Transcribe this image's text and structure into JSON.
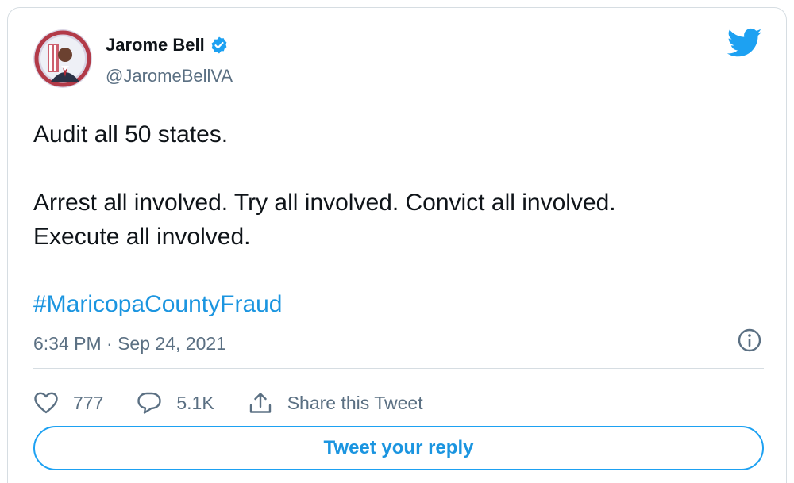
{
  "author": {
    "name": "Jarome Bell",
    "handle": "@JaromeBellVA",
    "verified": true
  },
  "tweet": {
    "line1": "Audit all 50 states.",
    "line2": "Arrest all involved. Try all involved. Convict all involved.",
    "line3": "Execute all involved.",
    "hashtag": "#MaricopaCountyFraud",
    "timestamp": "6:34 PM · Sep 24, 2021"
  },
  "actions": {
    "likes": "777",
    "replies": "5.1K",
    "share_label": "Share this Tweet",
    "reply_button_label": "Tweet your reply"
  },
  "icons": {
    "brand": "twitter-bird-icon",
    "verified": "verified-badge-icon",
    "info": "info-icon",
    "like": "heart-icon",
    "reply": "comment-bubble-icon",
    "share": "share-upload-icon"
  },
  "colors": {
    "brand_blue": "#1da1f2",
    "link_blue": "#1b95e0",
    "secondary_text": "#5b7083",
    "primary_text": "#0f1419",
    "border": "#d6dde2"
  }
}
